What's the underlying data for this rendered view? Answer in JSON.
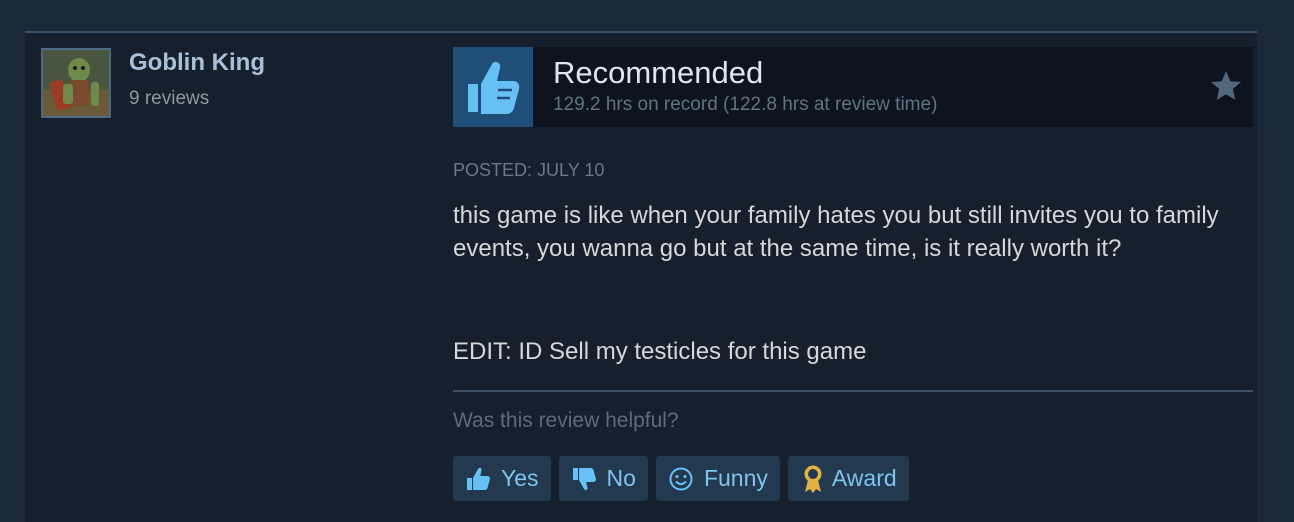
{
  "author": {
    "name": "Goblin King",
    "reviews": "9 reviews",
    "avatar_icon": "goblin-avatar-icon"
  },
  "vote": {
    "title": "Recommended",
    "hours": "129.2 hrs on record (122.8 hrs at review time)",
    "thumb_icon": "thumbs-up-icon",
    "star_icon": "star-icon"
  },
  "review": {
    "posted": "POSTED: JULY 10",
    "body": "this game is like when your family hates you but still invites you to family events, you wanna go but at the same time, is it really worth it?",
    "edit": "EDIT: ID Sell my testicles for this game"
  },
  "helpful": {
    "question": "Was this review helpful?",
    "buttons": [
      {
        "label": "Yes",
        "icon": "thumbs-up-icon"
      },
      {
        "label": "No",
        "icon": "thumbs-down-icon"
      },
      {
        "label": "Funny",
        "icon": "smiley-icon"
      },
      {
        "label": "Award",
        "icon": "award-ribbon-icon"
      }
    ]
  },
  "colors": {
    "background": "#1b2838",
    "card": "#16202d",
    "accent_blue": "#67c1f5",
    "thumb_box": "#1f4e78",
    "award_gold": "#e3b341"
  }
}
